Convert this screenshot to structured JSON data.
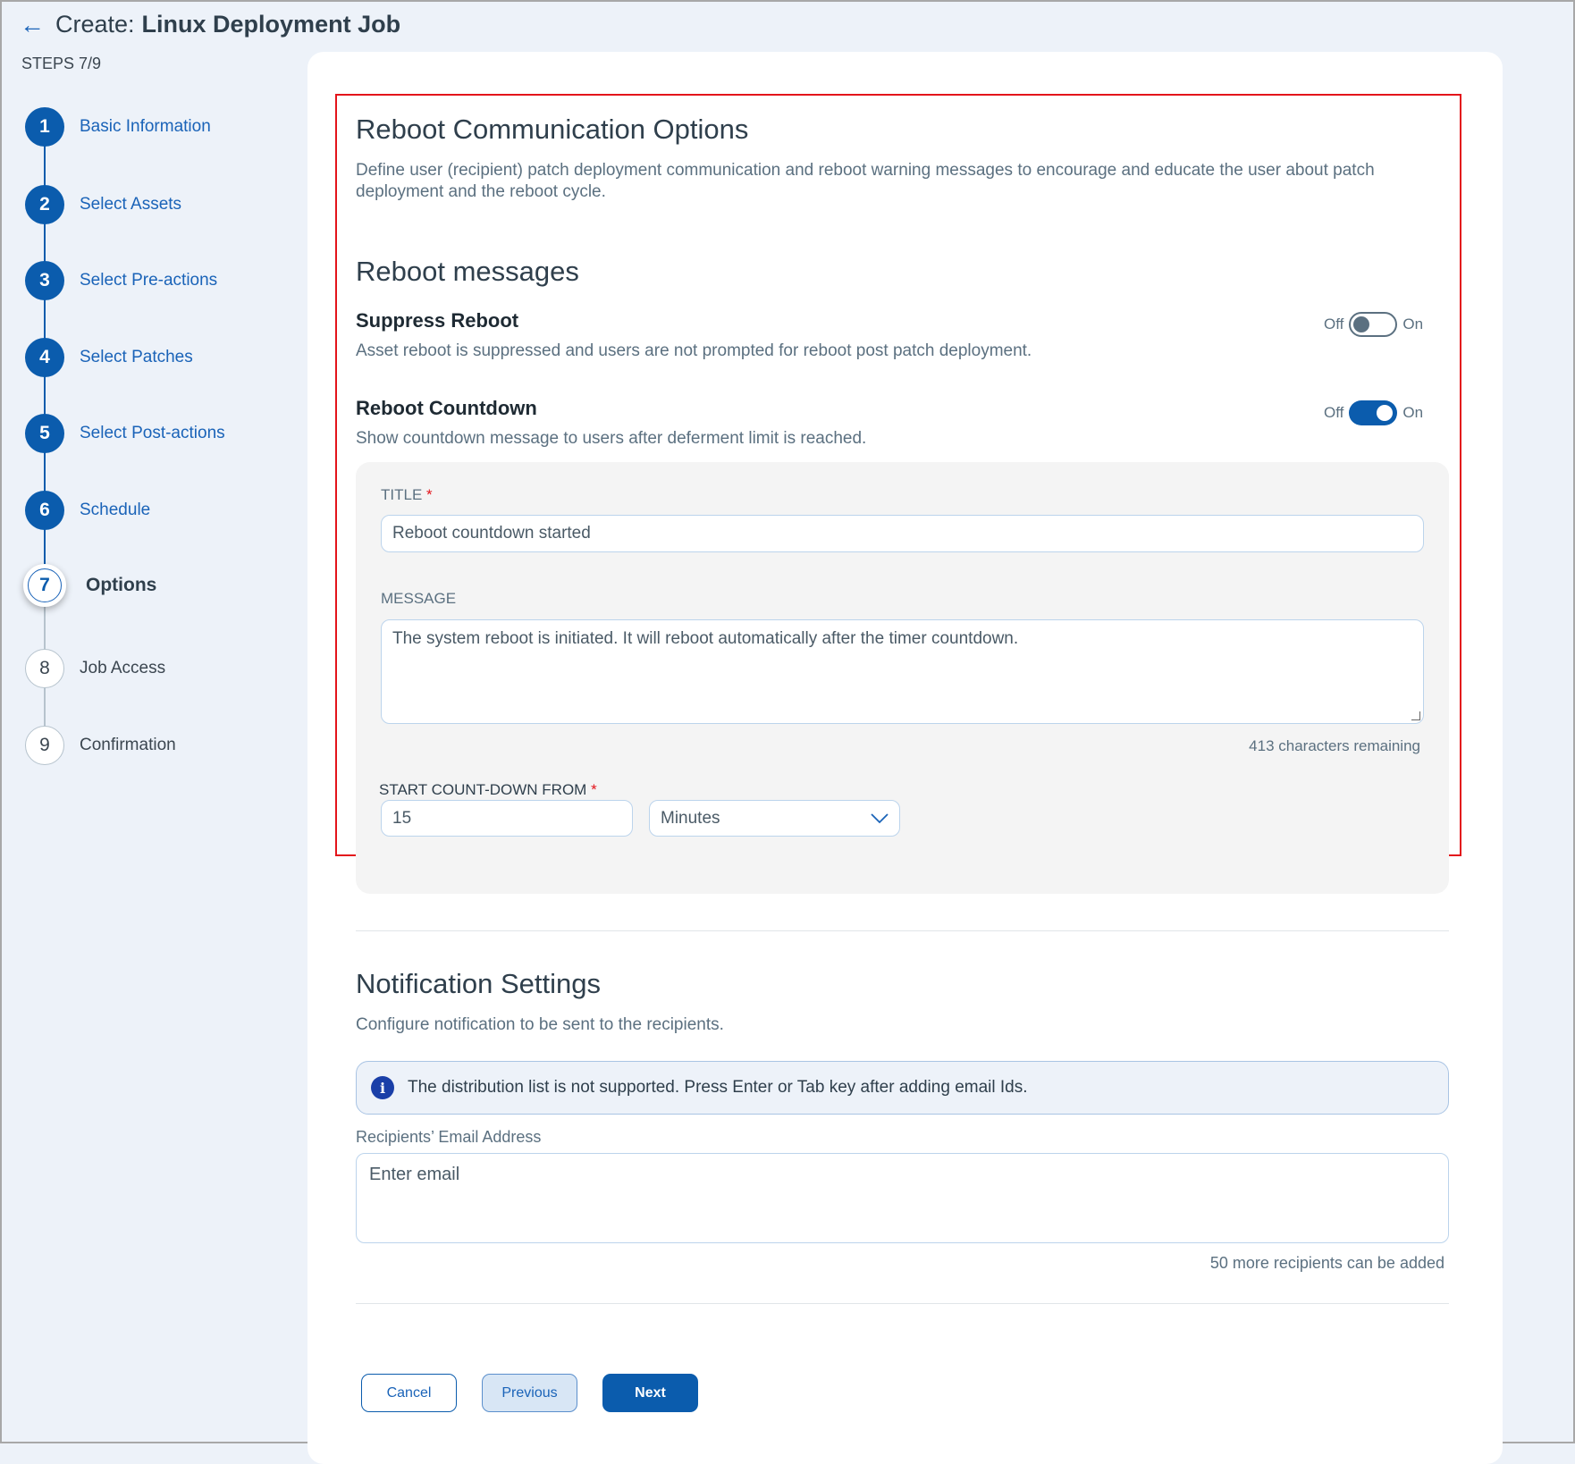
{
  "header": {
    "back_icon": "arrow-left-icon",
    "prefix": "Create:",
    "title": "Linux Deployment Job"
  },
  "steps_label": "STEPS 7/9",
  "steps": [
    {
      "num": "1",
      "label": "Basic Information",
      "state": "done"
    },
    {
      "num": "2",
      "label": "Select Assets",
      "state": "done"
    },
    {
      "num": "3",
      "label": "Select Pre-actions",
      "state": "done"
    },
    {
      "num": "4",
      "label": "Select Patches",
      "state": "done"
    },
    {
      "num": "5",
      "label": "Select Post-actions",
      "state": "done"
    },
    {
      "num": "6",
      "label": "Schedule",
      "state": "done"
    },
    {
      "num": "7",
      "label": "Options",
      "state": "current"
    },
    {
      "num": "8",
      "label": "Job Access",
      "state": "todo"
    },
    {
      "num": "9",
      "label": "Confirmation",
      "state": "todo"
    }
  ],
  "reboot": {
    "title": "Reboot Communication Options",
    "desc": "Define user (recipient) patch deployment communication and reboot warning messages to encourage and educate the user about patch deployment and the reboot cycle.",
    "messages_title": "Reboot messages",
    "suppress": {
      "title": "Suppress Reboot",
      "desc": "Asset reboot is suppressed and users are not prompted for reboot post patch deployment.",
      "off": "Off",
      "on": "On",
      "enabled": false
    },
    "countdown": {
      "title": "Reboot Countdown",
      "desc": "Show countdown message to users after deferment limit is reached.",
      "off": "Off",
      "on": "On",
      "enabled": true
    },
    "title_label": "TITLE",
    "required": "*",
    "title_value": "Reboot countdown started",
    "message_label": "MESSAGE",
    "message_value": "The system reboot is initiated. It will reboot automatically after the timer countdown.",
    "chars_remaining": "413 characters remaining",
    "start_label": "START COUNT-DOWN FROM",
    "start_value": "15",
    "unit_value": "Minutes"
  },
  "notification": {
    "title": "Notification Settings",
    "desc": "Configure notification to be sent to the recipients.",
    "info": "The distribution list is not supported. Press Enter or Tab key after adding email Ids.",
    "email_label": "Recipients’ Email Address",
    "email_placeholder": "Enter email",
    "recipients_left": "50 more recipients can be added"
  },
  "buttons": {
    "cancel": "Cancel",
    "previous": "Previous",
    "next": "Next"
  },
  "colors": {
    "primary": "#0b5cad",
    "highlight": "#e3141b"
  }
}
